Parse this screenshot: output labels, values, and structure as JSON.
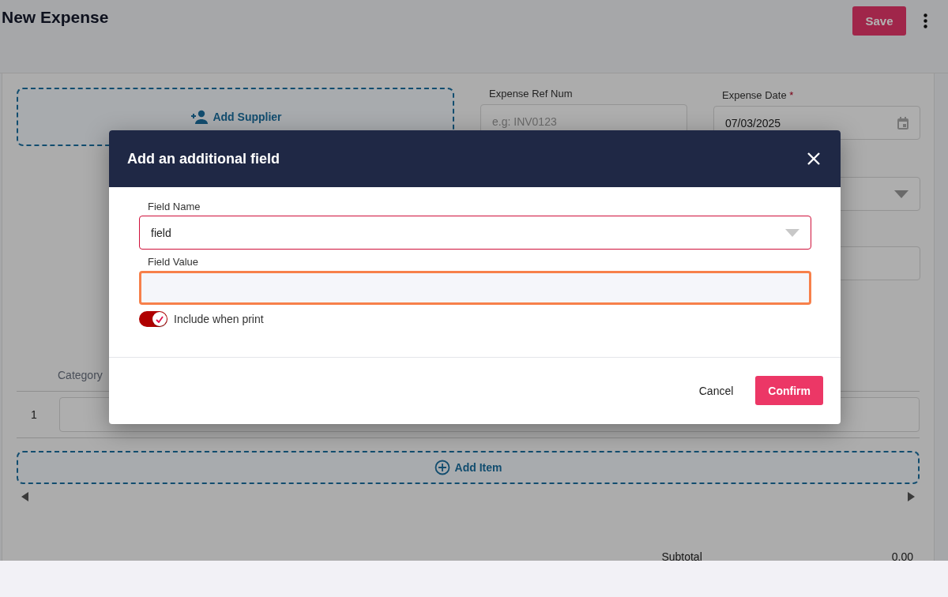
{
  "page": {
    "title": "New Expense",
    "save_button": "Save"
  },
  "supplier": {
    "label": "Add Supplier"
  },
  "fields": [
    {
      "label": "Expense Ref Num",
      "placeholder": "e.g: INV0123"
    },
    {
      "label": "Expense Date",
      "required_mark": "*",
      "value": "07/03/2025"
    }
  ],
  "items": {
    "columns": [
      "Category"
    ],
    "rows": [
      {
        "number": "1"
      }
    ],
    "add_label": "Add Item"
  },
  "totals": [
    {
      "label": "Subtotal",
      "value": "0.00"
    }
  ],
  "dialog": {
    "title": "Add an additional field",
    "fields": [
      {
        "kind": "select",
        "label": "Field Name",
        "value": "field",
        "focused": false
      },
      {
        "kind": "text",
        "label": "Field Value",
        "focused": true
      }
    ],
    "toggle": {
      "label": "Include when print",
      "on": true
    },
    "buttons": [
      {
        "label": "Cancel",
        "primary": false
      },
      {
        "label": "Confirm",
        "primary": true
      }
    ]
  }
}
